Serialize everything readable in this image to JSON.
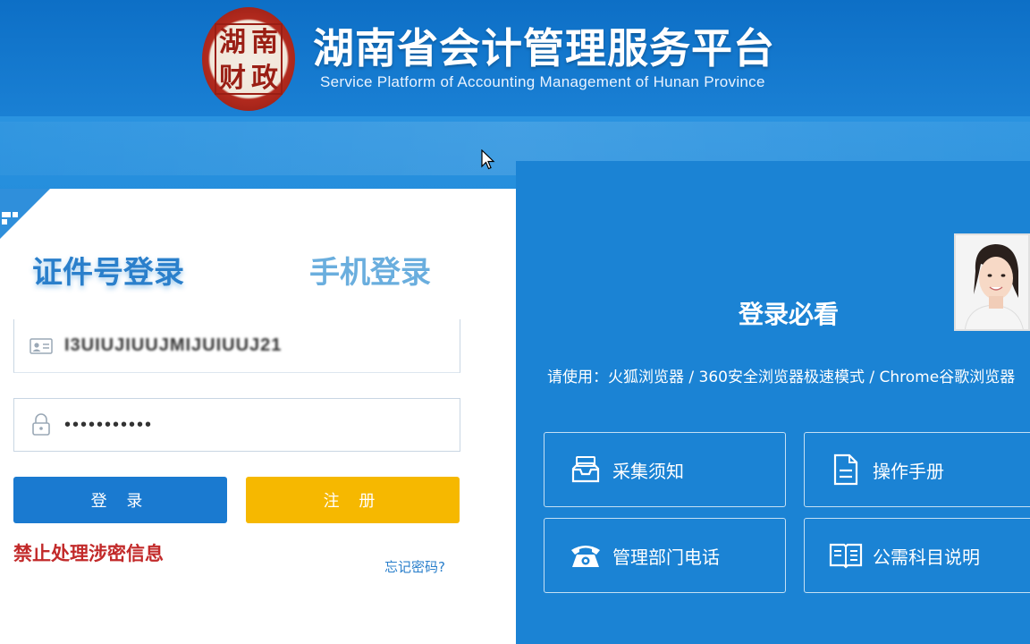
{
  "header": {
    "logo_seal_chars": [
      "湖",
      "南",
      "财",
      "政"
    ],
    "title": "湖南省会计管理服务平台",
    "subtitle": "Service Platform of Accounting Management of Hunan Province"
  },
  "login": {
    "tabs": [
      {
        "label": "证件号登录",
        "active": true
      },
      {
        "label": "手机登录",
        "active": false
      }
    ],
    "id_field": {
      "value": "I3UIUJIUUJMIJUIUUJ21",
      "icon": "id-card-icon"
    },
    "password_field": {
      "value": "•••••••••••",
      "icon": "lock-icon"
    },
    "login_button": "登 录",
    "register_button": "注 册",
    "warning": "禁止处理涉密信息",
    "forgot_password": "忘记密码?"
  },
  "notice": {
    "title": "登录必看",
    "browser_tip": "请使用：火狐浏览器 / 360安全浏览器极速模式 / Chrome谷歌浏览器",
    "tiles": [
      {
        "label": "采集须知",
        "icon": "inbox-tray-icon"
      },
      {
        "label": "操作手册",
        "icon": "document-icon"
      },
      {
        "label": "管理部门电话",
        "icon": "telephone-icon"
      },
      {
        "label": "公需科目说明",
        "icon": "open-book-icon"
      }
    ]
  },
  "colors": {
    "header_blue": "#0d6fc6",
    "panel_blue": "#1b83d4",
    "login_button": "#1a7ad0",
    "register_button": "#f6b800",
    "warning_red": "#c22a2a",
    "seal_red": "#9a1e14"
  }
}
